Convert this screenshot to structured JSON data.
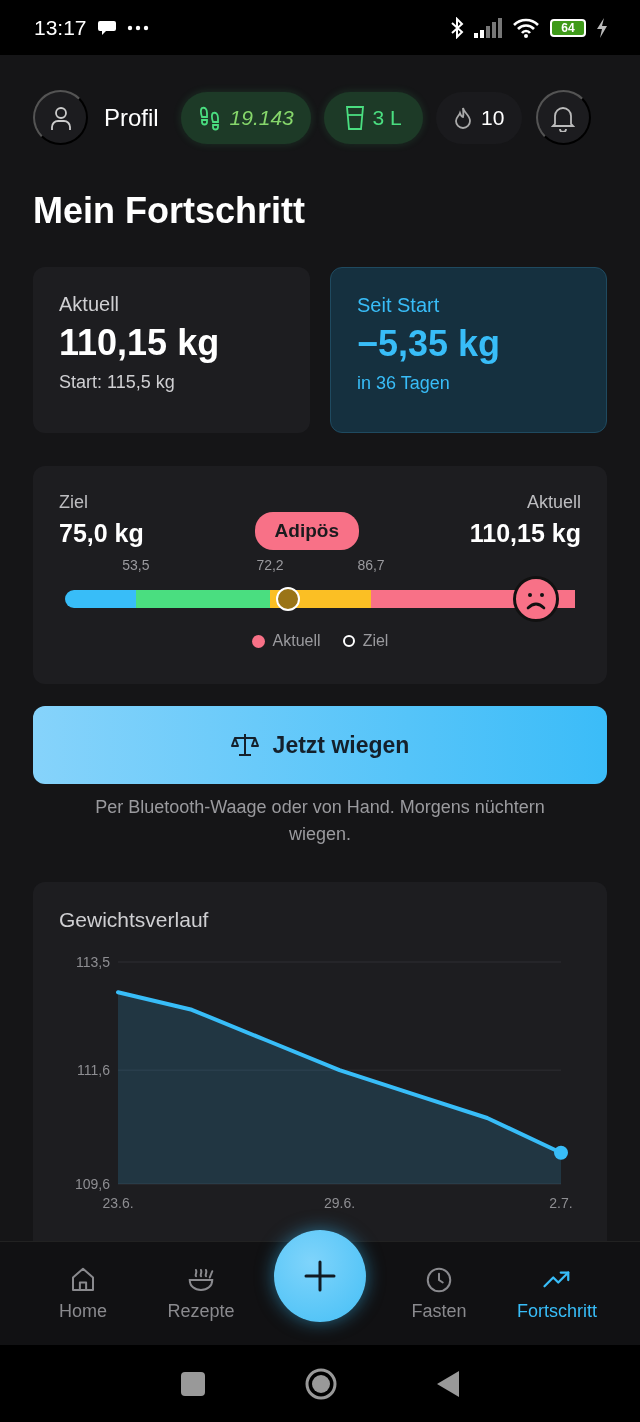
{
  "status_bar": {
    "time": "13:17",
    "battery": "64"
  },
  "header": {
    "profile_label": "Profil",
    "steps": "19.143",
    "water": "3 L",
    "streak": "10"
  },
  "title": "Mein Fortschritt",
  "stats": [
    {
      "kind": "plain",
      "label": "Aktuell",
      "value": "110,15 kg",
      "note": "Start: 115,5 kg"
    },
    {
      "kind": "highlight",
      "label": "Seit Start",
      "value": "−5,35 kg",
      "note": "in 36 Tagen"
    }
  ],
  "bmi": {
    "goal_label": "Ziel",
    "goal_value": "75,0 kg",
    "category": "Adipös",
    "current_label": "Aktuell",
    "current_value": "110,15 kg",
    "segments": [
      {
        "color": "#38bdf8"
      },
      {
        "color": "#4ade80"
      },
      {
        "color": "#fbbf24"
      },
      {
        "color": "#f87187"
      }
    ],
    "boundaries": [
      {
        "label": "53,5",
        "level": 0.139
      },
      {
        "label": "72,2",
        "level": 0.402
      },
      {
        "label": "86,7",
        "level": 0.6
      }
    ],
    "goal_marker": {
      "level": 0.437
    },
    "current_marker": {
      "level": 0.924
    },
    "legend": [
      {
        "kind": "dot",
        "label": "Aktuell",
        "color": "#f87187"
      },
      {
        "kind": "ring",
        "label": "Ziel"
      }
    ]
  },
  "weigh_button": {
    "label": "Jetzt wiegen"
  },
  "hint": "Per Bluetooth-Waage oder von Hand. Morgens nüchtern wiegen.",
  "chart_card": {
    "title": "Gewichtsverlauf",
    "chart_data": {
      "type": "area",
      "categories": [
        "23.6.",
        null,
        null,
        "29.6.",
        null,
        null,
        "2.7."
      ],
      "series": [
        {
          "color": "#38bdf8",
          "values": [
            112.97,
            112.66,
            112.13,
            111.6,
            111.18,
            110.76,
            110.15
          ]
        }
      ],
      "ylim": [
        109.6,
        113.5
      ],
      "yticks": [
        {
          "value": 109.6,
          "label": "109,6"
        },
        {
          "value": 111.6,
          "label": "111,6"
        },
        {
          "value": 113.5,
          "label": "113,5"
        }
      ]
    }
  },
  "nav": [
    {
      "kind": "home",
      "label": "Home",
      "selected": false
    },
    {
      "kind": "recipes",
      "label": "Rezepte",
      "selected": false
    },
    {
      "kind": "fasting",
      "label": "Fasten",
      "selected": false
    },
    {
      "kind": "progress",
      "label": "Fortschritt",
      "selected": true
    }
  ]
}
